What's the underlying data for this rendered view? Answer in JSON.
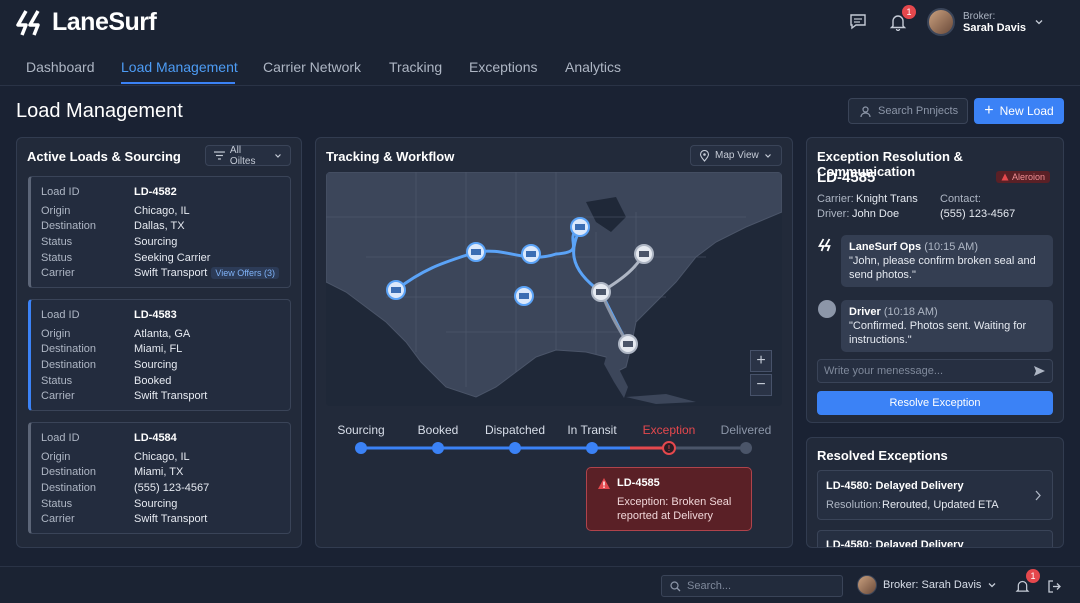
{
  "app": {
    "name": "LaneSurf"
  },
  "header": {
    "broker_label": "Broker:",
    "broker_name": "Sarah Davis",
    "notification_count": "1"
  },
  "nav": {
    "tabs": [
      "Dashboard",
      "Load Management",
      "Carrier Network",
      "Tracking",
      "Exceptions",
      "Analytics"
    ],
    "active": "Load Management"
  },
  "page": {
    "title": "Load Management",
    "search_placeholder": "Search Pnnjects",
    "new_load_label": "New Load"
  },
  "active_loads": {
    "title": "Active Loads & Sourcing",
    "filter_label": "All Oiltes",
    "field_labels": [
      "Load ID",
      "Origin",
      "Destination",
      "Status",
      "Status",
      "Carrier"
    ],
    "cards": [
      {
        "id": "LD-4582",
        "origin": "Chicago, IL",
        "destination": "Dallas, TX",
        "status1": "Sourcing",
        "status2": "Seeking Carrier",
        "carrier": "Swift Transport",
        "offers": "View Offers (3)"
      },
      {
        "id": "LD-4583",
        "origin": "Atlanta, GA",
        "destination": "Miami, FL",
        "status1": "Sourcing",
        "status2": "Booked",
        "carrier": "Swift Transport"
      },
      {
        "id": "LD-4584",
        "origin": "Chicago, IL",
        "destination": "Miami, TX",
        "status1": "(555) 123-4567",
        "status2": "Sourcing",
        "carrier": "Swift Transport"
      }
    ],
    "card3_labels": [
      "Load ID",
      "Origin",
      "Destination",
      "Destination",
      "Status",
      "Carrier"
    ]
  },
  "tracking": {
    "title": "Tracking & Workflow",
    "map_view_label": "Map View",
    "zoom_in": "+",
    "zoom_out": "−",
    "steps": [
      "Sourcing",
      "Booked",
      "Dispatched",
      "In Transit",
      "Exception",
      "Delivered"
    ],
    "exception_tooltip": {
      "id": "LD-4585",
      "line1": "Exception: Broken Seal",
      "line2": "reported at Delivery"
    }
  },
  "exception": {
    "title": "Exception Resolution & Communication",
    "load_id": "LD-4585",
    "alert_badge": "Aleroion",
    "carrier_label": "Carrier:",
    "carrier": "Knight Trans",
    "driver_label": "Driver:",
    "driver": "John Doe",
    "contact_label": "Contact:",
    "contact": "(555) 123-4567",
    "messages": [
      {
        "sender": "LaneSurf Ops",
        "time": "(10:15 AM)",
        "text1": "\"John, please confirm broken seal and",
        "text2": "send photos.\""
      },
      {
        "sender": "Driver",
        "time": "(10:18 AM)",
        "text1": "\"Confirmed. Photos sent. Waiting for",
        "text2": "instructions.\""
      }
    ],
    "message_placeholder": "Write your menessage...",
    "resolve_label": "Resolve Exception"
  },
  "resolved": {
    "title": "Resolved Exceptions",
    "items": [
      {
        "title": "LD-4580: Delayed Delivery",
        "resolution_label": "Resolution:",
        "resolution": "Rerouted, Updated ETA"
      },
      {
        "title": "LD-4580: Delayed Delivery"
      }
    ]
  },
  "footer": {
    "search_placeholder": "Search...",
    "broker": "Broker: Sarah Davis",
    "notification_count": "1"
  },
  "colors": {
    "accent": "#3b82f6",
    "exception": "#e5484d",
    "background": "#1a2233"
  }
}
